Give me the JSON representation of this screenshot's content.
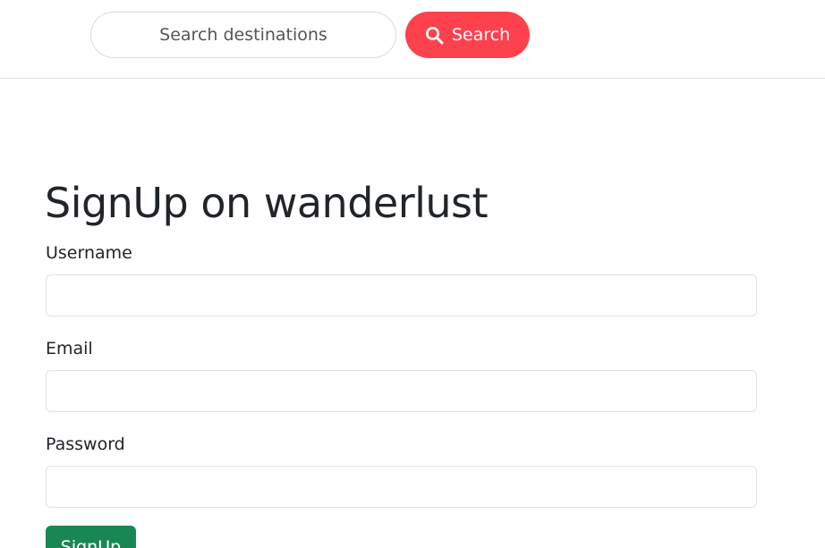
{
  "navbar": {
    "search": {
      "placeholder": "Search destinations",
      "value": ""
    },
    "search_button": {
      "icon": "search-icon",
      "label": "Search"
    }
  },
  "main": {
    "title": "SignUp on wanderlust",
    "fields": [
      {
        "label": "Username",
        "value": ""
      },
      {
        "label": "Email",
        "value": ""
      },
      {
        "label": "Password",
        "value": ""
      }
    ],
    "submit_label": "SignUp"
  },
  "colors": {
    "search_button": "#fe424d",
    "signup_button": "#198754",
    "text": "#212529"
  }
}
